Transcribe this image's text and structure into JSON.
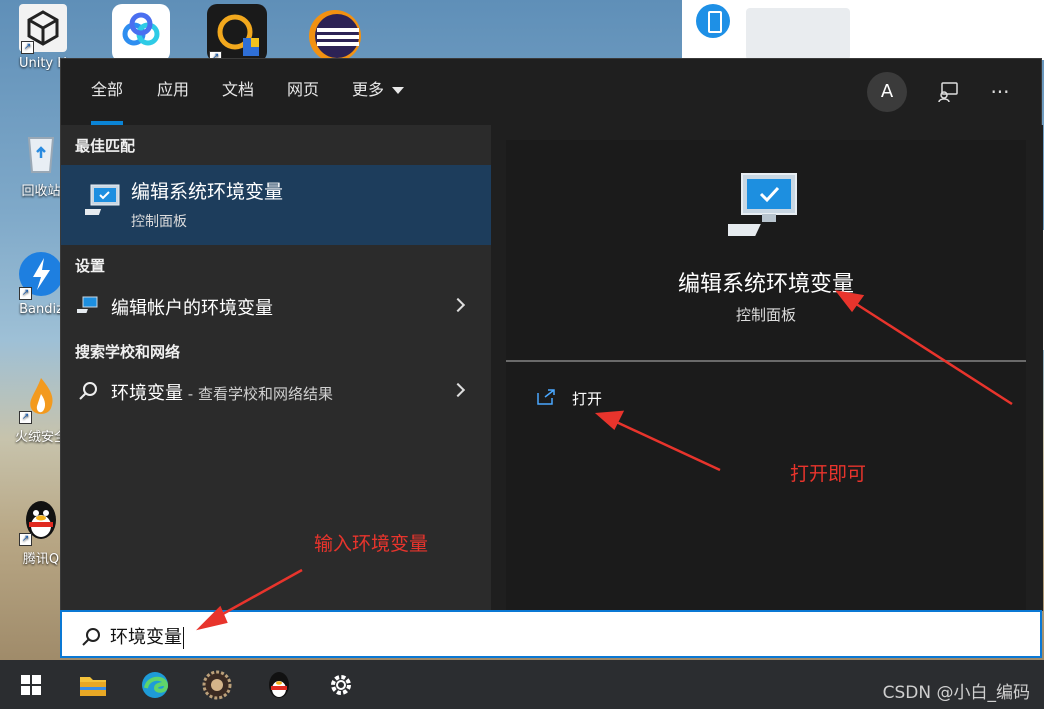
{
  "desktop": {
    "icons": [
      {
        "label": "Unity H",
        "icon": "unity-icon"
      },
      {
        "label": "",
        "icon": "baidu-netdisk-icon"
      },
      {
        "label": "",
        "icon": "security-app-icon"
      },
      {
        "label": "",
        "icon": "eclipse-icon"
      },
      {
        "label": "回收站",
        "icon": "recycle-bin-icon"
      },
      {
        "label": "Bandiz",
        "icon": "bandizip-icon"
      },
      {
        "label": "火绒安全",
        "icon": "huorong-icon"
      },
      {
        "label": "腾讯Q",
        "icon": "qq-icon"
      }
    ]
  },
  "start": {
    "tabs": [
      {
        "label": "全部",
        "active": true
      },
      {
        "label": "应用",
        "active": false
      },
      {
        "label": "文档",
        "active": false
      },
      {
        "label": "网页",
        "active": false
      },
      {
        "label": "更多",
        "active": false
      }
    ],
    "avatar_letter": "A",
    "header_icons": [
      "feedback-icon",
      "more-options-icon"
    ],
    "sections": {
      "best_match": "最佳匹配",
      "settings": "设置",
      "search_web": "搜索学校和网络"
    },
    "best_match": {
      "title": "编辑系统环境变量",
      "subtitle": "控制面板",
      "icon": "control-panel-icon"
    },
    "settings_item": {
      "label": "编辑帐户的环境变量",
      "icon": "settings-monitor-icon"
    },
    "web_item": {
      "label": "环境变量",
      "suffix": " - 查看学校和网络结果",
      "icon": "search-icon"
    },
    "preview": {
      "title": "编辑系统环境变量",
      "subtitle": "控制面板",
      "open_label": "打开",
      "icon": "control-panel-icon"
    }
  },
  "search": {
    "value": "环境变量"
  },
  "taskbar": {
    "items": [
      "windows-start-icon",
      "file-explorer-icon",
      "edge-icon",
      "game-icon",
      "qq-icon",
      "settings-gear-icon"
    ],
    "watermark": "CSDN @小白_编码"
  },
  "annotations": {
    "input_hint": "输入环境变量",
    "open_hint": "打开即可"
  },
  "colors": {
    "accent": "#0a84d6",
    "highlight": "#1d3d5c",
    "annotation": "#e8342c"
  }
}
